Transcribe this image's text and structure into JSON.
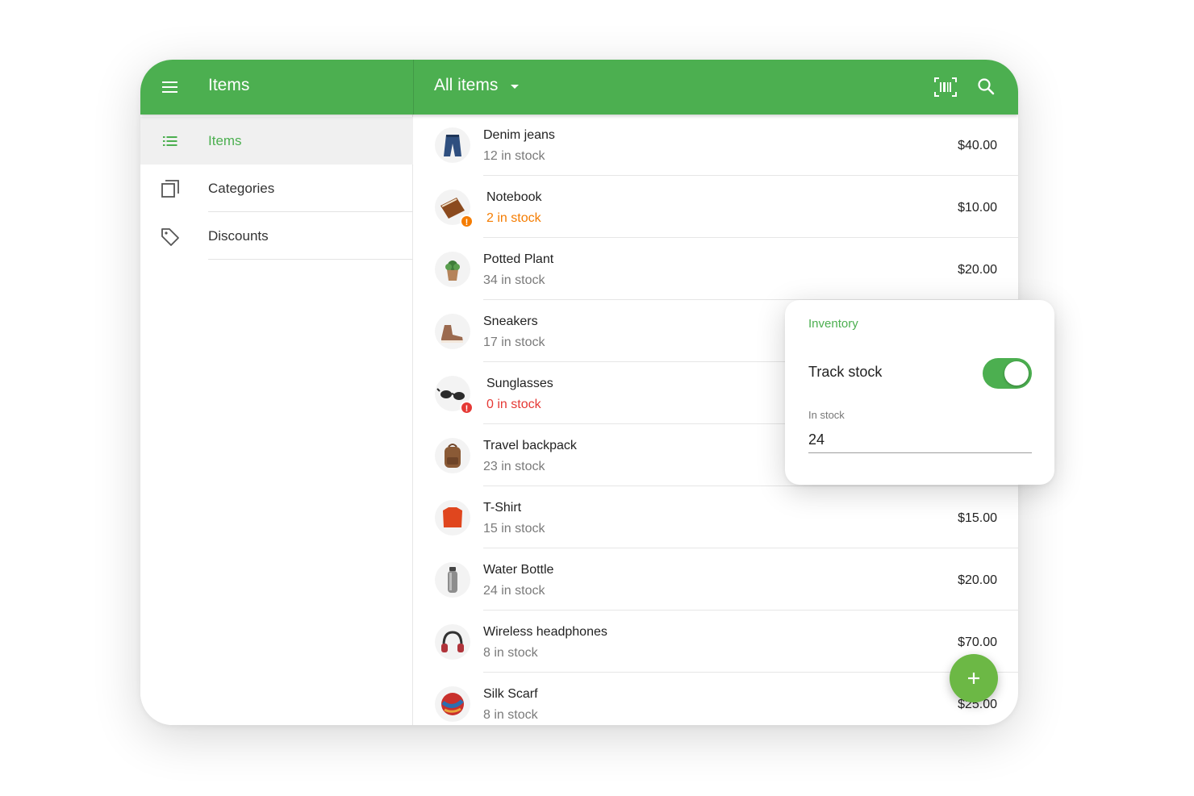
{
  "colors": {
    "accent": "#4CAF50",
    "warning": "#F57C00",
    "danger": "#E53935",
    "fab": "#6CB845"
  },
  "header": {
    "title": "Items",
    "filter_label": "All items",
    "icons": [
      "menu-icon",
      "barcode-icon",
      "search-icon"
    ]
  },
  "sidebar": {
    "items": [
      {
        "label": "Items",
        "icon": "list-icon",
        "active": true
      },
      {
        "label": "Categories",
        "icon": "copy-icon",
        "active": false
      },
      {
        "label": "Discounts",
        "icon": "tag-icon",
        "active": false
      }
    ]
  },
  "items": [
    {
      "name": "Denim jeans",
      "stock": "12 in stock",
      "price": "$40.00",
      "icon": "jeans-thumbnail",
      "status": "normal"
    },
    {
      "name": "Notebook",
      "stock": "2 in stock",
      "price": "$10.00",
      "icon": "notebook-thumbnail",
      "status": "low"
    },
    {
      "name": "Potted Plant",
      "stock": "34 in stock",
      "price": "$20.00",
      "icon": "plant-thumbnail",
      "status": "normal"
    },
    {
      "name": "Sneakers",
      "stock": "17 in stock",
      "price": "",
      "icon": "sneakers-thumbnail",
      "status": "normal"
    },
    {
      "name": "Sunglasses",
      "stock": "0 in stock",
      "price": "",
      "icon": "sunglasses-thumbnail",
      "status": "out"
    },
    {
      "name": "Travel backpack",
      "stock": "23 in stock",
      "price": "",
      "icon": "backpack-thumbnail",
      "status": "normal"
    },
    {
      "name": "T-Shirt",
      "stock": "15 in stock",
      "price": "$15.00",
      "icon": "tshirt-thumbnail",
      "status": "normal"
    },
    {
      "name": "Water Bottle",
      "stock": "24 in stock",
      "price": "$20.00",
      "icon": "bottle-thumbnail",
      "status": "normal"
    },
    {
      "name": "Wireless headphones",
      "stock": "8 in stock",
      "price": "$70.00",
      "icon": "headphones-thumbnail",
      "status": "normal"
    },
    {
      "name": "Silk Scarf",
      "stock": "8 in stock",
      "price": "$25.00",
      "icon": "scarf-thumbnail",
      "status": "normal"
    }
  ],
  "inventory_card": {
    "title": "Inventory",
    "track_label": "Track stock",
    "track_on": true,
    "in_stock_label": "In stock",
    "in_stock_value": "24"
  },
  "fab": {
    "label": "+",
    "icon": "plus-icon"
  }
}
